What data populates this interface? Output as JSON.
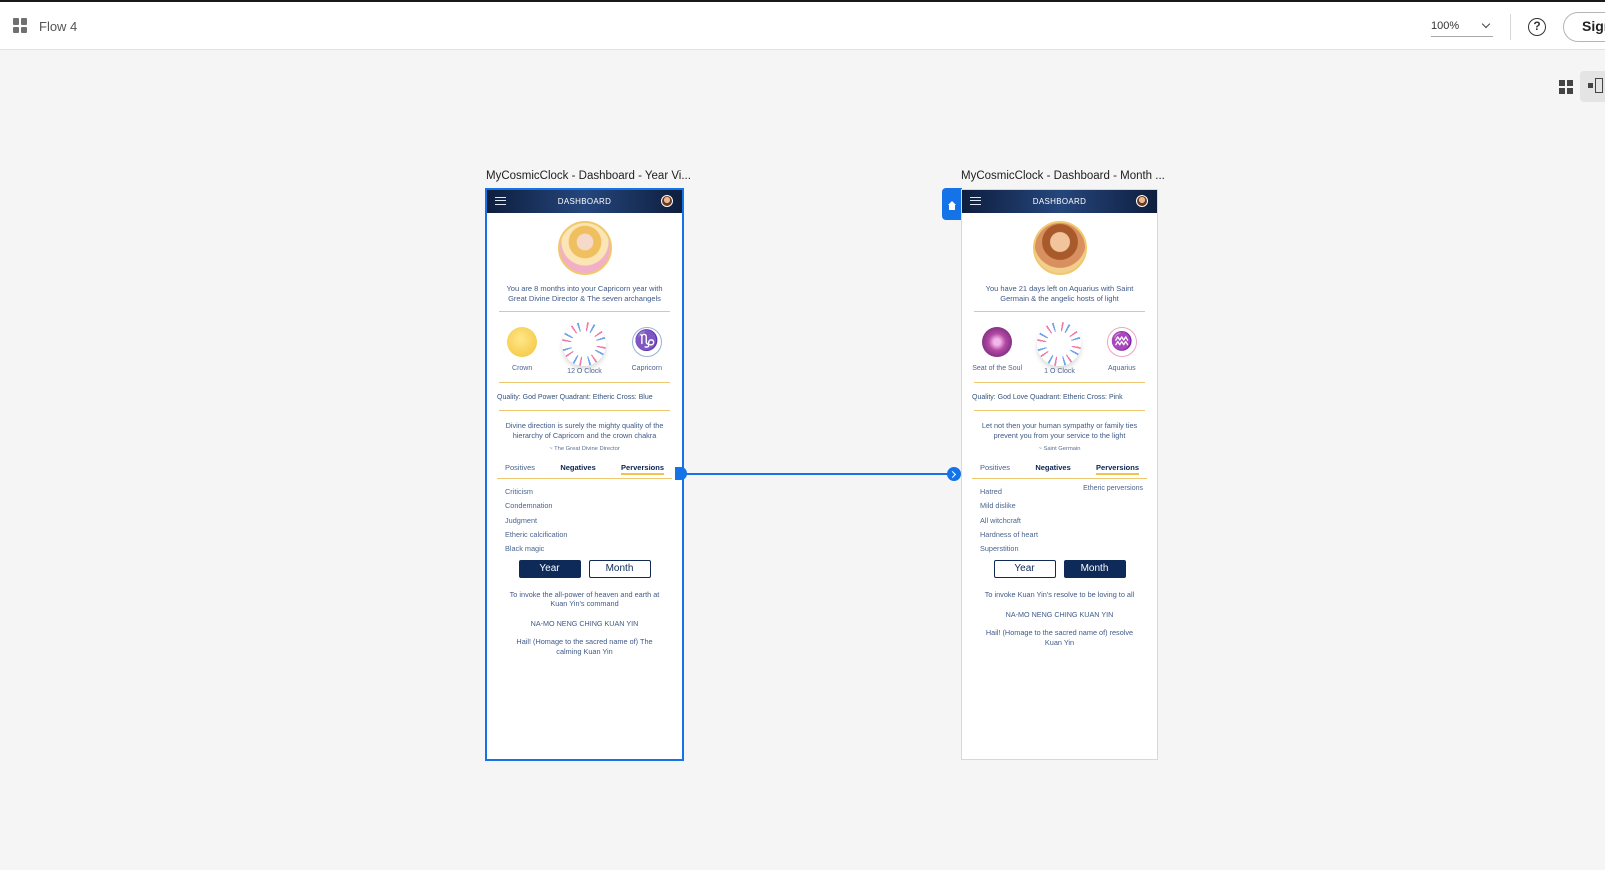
{
  "header": {
    "doc_title": "Flow 4",
    "zoom": "100%",
    "sign_label": "Sign"
  },
  "artboards": [
    {
      "title": "MyCosmicClock - Dashboard - Year Vi...",
      "header_title": "DASHBOARD",
      "intro": "You are 8 months into your Capricorn year with Great Divine Director & The seven archangels",
      "icons": [
        {
          "label": "Crown",
          "icon": "crown-chakra-icon"
        },
        {
          "label": "12 O Clock",
          "icon": "cosmic-clock-icon"
        },
        {
          "label": "Capricorn",
          "icon": "capricorn-icon",
          "glyph": "♑"
        }
      ],
      "quality": "Quality: God Power  Quadrant: Etheric  Cross: Blue",
      "quote": "Divine direction is surely the mighty quality of the hierarchy of Capricorn and the crown chakra",
      "attribution": "~ The Great Divine Director",
      "tabs": [
        "Positives",
        "Negatives",
        "Perversions"
      ],
      "list": [
        "Criticism",
        "Condemnation",
        "Judgment",
        "Etheric calcification",
        "Black magic"
      ],
      "list_note": "",
      "buttons": [
        "Year",
        "Month"
      ],
      "invocation": "To invoke the all-power of heaven and earth at Kuan Yin's command",
      "mantra": "NA-MO NENG CHING KUAN YIN",
      "hail": "Hail! (Homage to the sacred name of) The calming Kuan Yin"
    },
    {
      "title": "MyCosmicClock - Dashboard - Month ...",
      "header_title": "DASHBOARD",
      "intro": "You have 21 days left on Aquarius with Saint Germain & the angelic hosts of light",
      "icons": [
        {
          "label": "Seat of the Soul",
          "icon": "soul-chakra-icon"
        },
        {
          "label": "1 O Clock",
          "icon": "cosmic-clock-icon"
        },
        {
          "label": "Aquarius",
          "icon": "aquarius-icon",
          "glyph": "♒"
        }
      ],
      "quality": "Quality: God Love   Quadrant: Etheric  Cross: Pink",
      "quote": "Let not then your human sympathy or family ties prevent you from your service to the light",
      "attribution": "~ Saint Germain",
      "tabs": [
        "Positives",
        "Negatives",
        "Perversions"
      ],
      "list": [
        "Hatred",
        "Mild dislike",
        "All witchcraft",
        "Hardness of heart",
        "Superstition"
      ],
      "list_note": "Etheric perversions",
      "buttons": [
        "Year",
        "Month"
      ],
      "invocation": "To invoke Kuan Yin's resolve to be loving to all",
      "mantra": "NA-MO NENG CHING KUAN YIN",
      "hail": "Hail! (Homage to the sacred name of) resolve Kuan Yin"
    }
  ],
  "colors": {
    "accent": "#1473e6",
    "header_navy": "#0e2a59",
    "gold": "#ecc76f",
    "text_blue": "#3f5a88"
  }
}
